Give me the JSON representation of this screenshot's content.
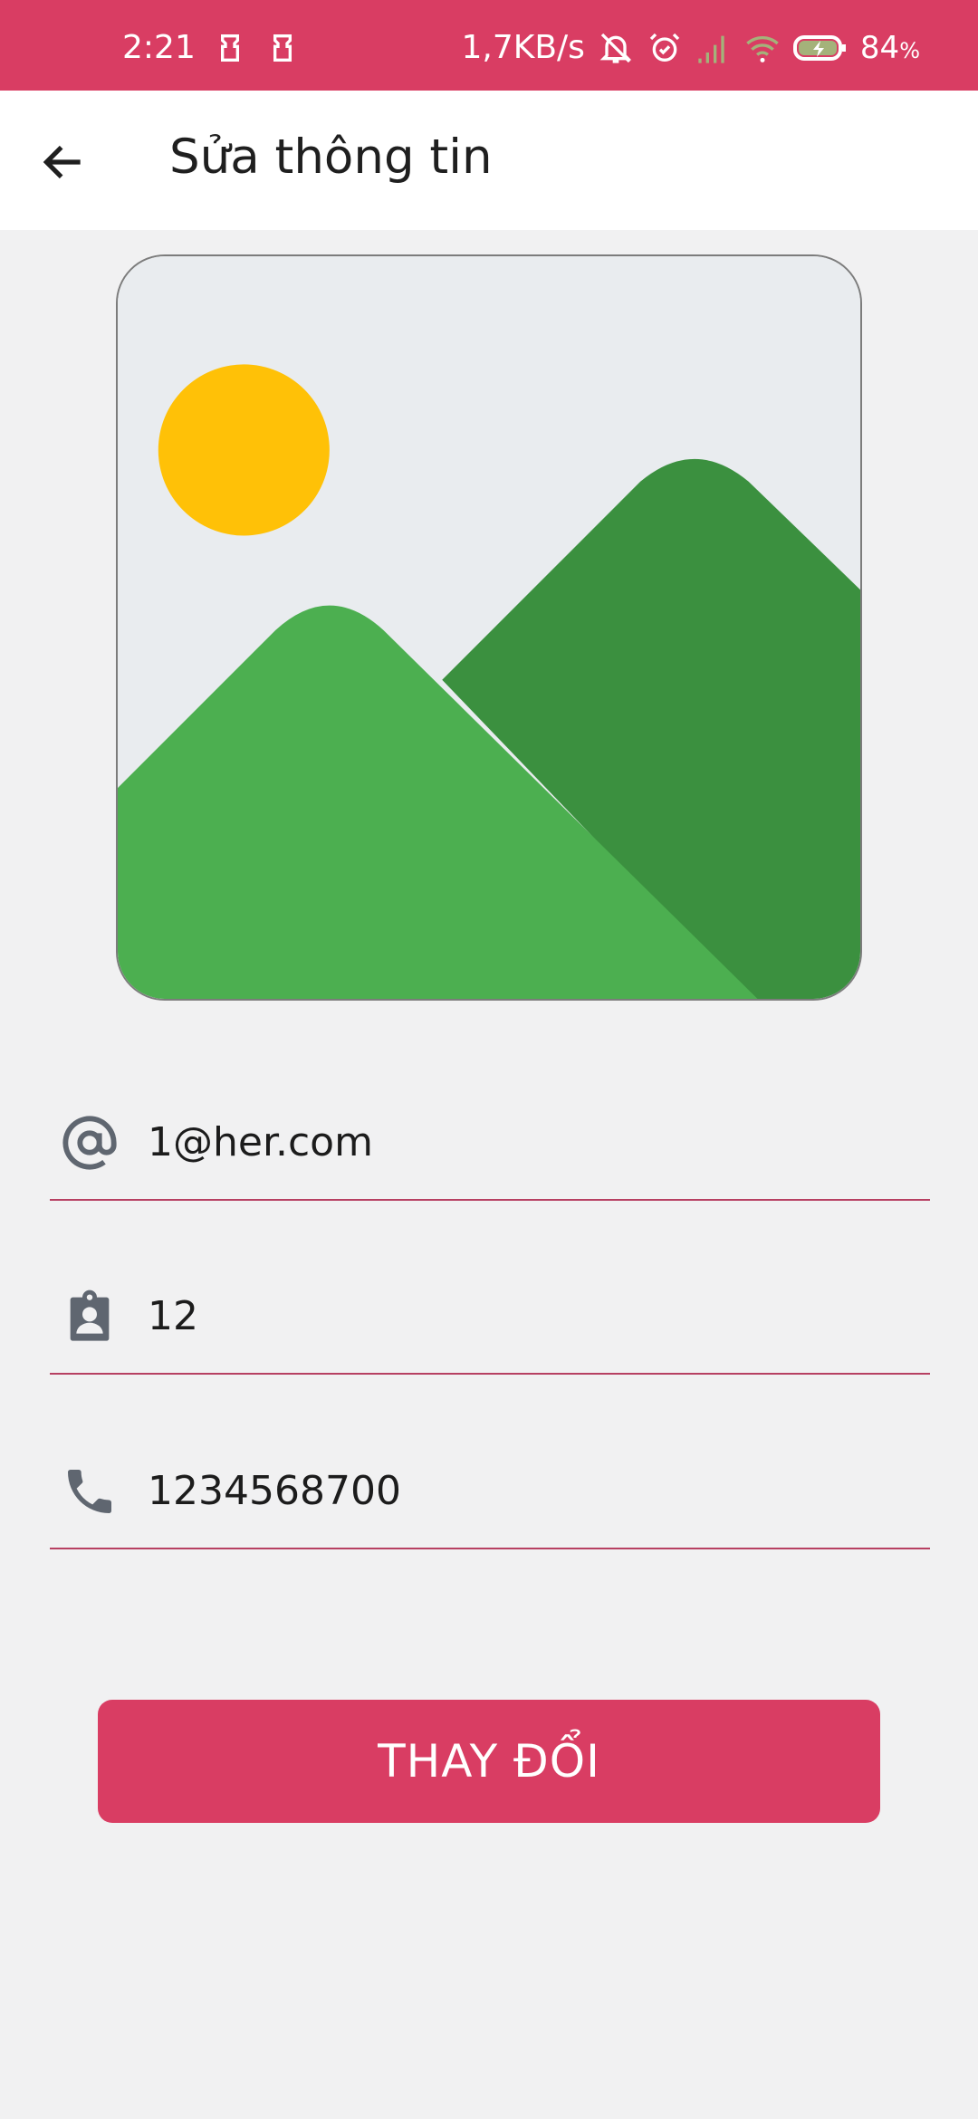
{
  "status_bar": {
    "time": "2:21",
    "network_speed": "1,7KB/s",
    "battery_value": "84",
    "battery_unit": "%",
    "icons": [
      "sim-icon",
      "sim-icon",
      "bell-off-icon",
      "alarm-icon",
      "signal-icon",
      "wifi-icon",
      "battery-charging-icon"
    ],
    "background_color": "#d93d63"
  },
  "app_bar": {
    "title": "Sửa thông tin",
    "back_icon": "arrow-left-icon"
  },
  "avatar": {
    "icon": "image-placeholder-icon"
  },
  "form": {
    "email": {
      "icon": "at-sign-icon",
      "value": "1@her.com"
    },
    "id": {
      "icon": "badge-icon",
      "value": "12"
    },
    "phone": {
      "icon": "phone-icon",
      "value": "1234568700"
    }
  },
  "submit_button": {
    "label": "THAY ĐỔI",
    "color": "#d93d63"
  },
  "colors": {
    "accent": "#d93d63",
    "underline": "#b74062",
    "background": "#f1f1f2"
  }
}
